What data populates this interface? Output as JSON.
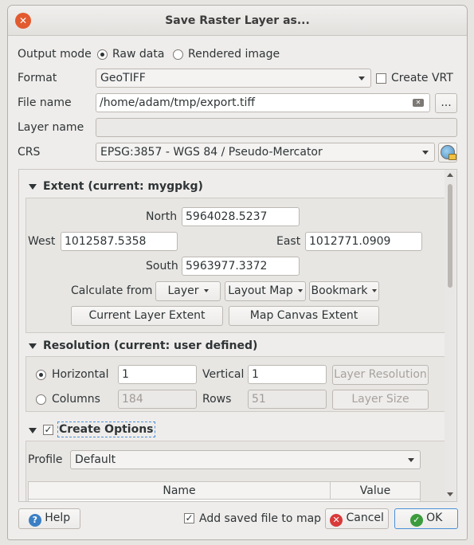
{
  "window": {
    "title": "Save Raster Layer as..."
  },
  "output_mode": {
    "label": "Output mode",
    "raw": "Raw data",
    "rendered": "Rendered image",
    "selected": "raw"
  },
  "format": {
    "label": "Format",
    "value": "GeoTIFF",
    "create_vrt": "Create VRT",
    "create_vrt_checked": false
  },
  "file_name": {
    "label": "File name",
    "value": "/home/adam/tmp/export.tiff",
    "browse": "..."
  },
  "layer_name": {
    "label": "Layer name",
    "value": ""
  },
  "crs": {
    "label": "CRS",
    "value": "EPSG:3857 - WGS 84 / Pseudo-Mercator"
  },
  "extent": {
    "title": "Extent (current: mygpkg)",
    "north_label": "North",
    "north": "5964028.5237",
    "west_label": "West",
    "west": "1012587.5358",
    "east_label": "East",
    "east": "1012771.0909",
    "south_label": "South",
    "south": "5963977.3372",
    "calc_from": "Calculate from",
    "layer_btn": "Layer",
    "layout_map_btn": "Layout Map",
    "bookmark_btn": "Bookmark",
    "current_layer_extent": "Current Layer Extent",
    "map_canvas_extent": "Map Canvas Extent"
  },
  "resolution": {
    "title": "Resolution (current: user defined)",
    "horizontal_label": "Horizontal",
    "horizontal": "1",
    "vertical_label": "Vertical",
    "vertical": "1",
    "layer_resolution": "Layer Resolution",
    "columns_label": "Columns",
    "columns": "184",
    "rows_label": "Rows",
    "rows": "51",
    "layer_size": "Layer Size",
    "selected": "horizontal"
  },
  "create_options": {
    "title": "Create Options",
    "checked": true,
    "profile_label": "Profile",
    "profile": "Default",
    "columns": [
      "Name",
      "Value"
    ]
  },
  "footer": {
    "help": "Help",
    "add_saved": "Add saved file to map",
    "add_saved_checked": true,
    "cancel": "Cancel",
    "ok": "OK"
  }
}
